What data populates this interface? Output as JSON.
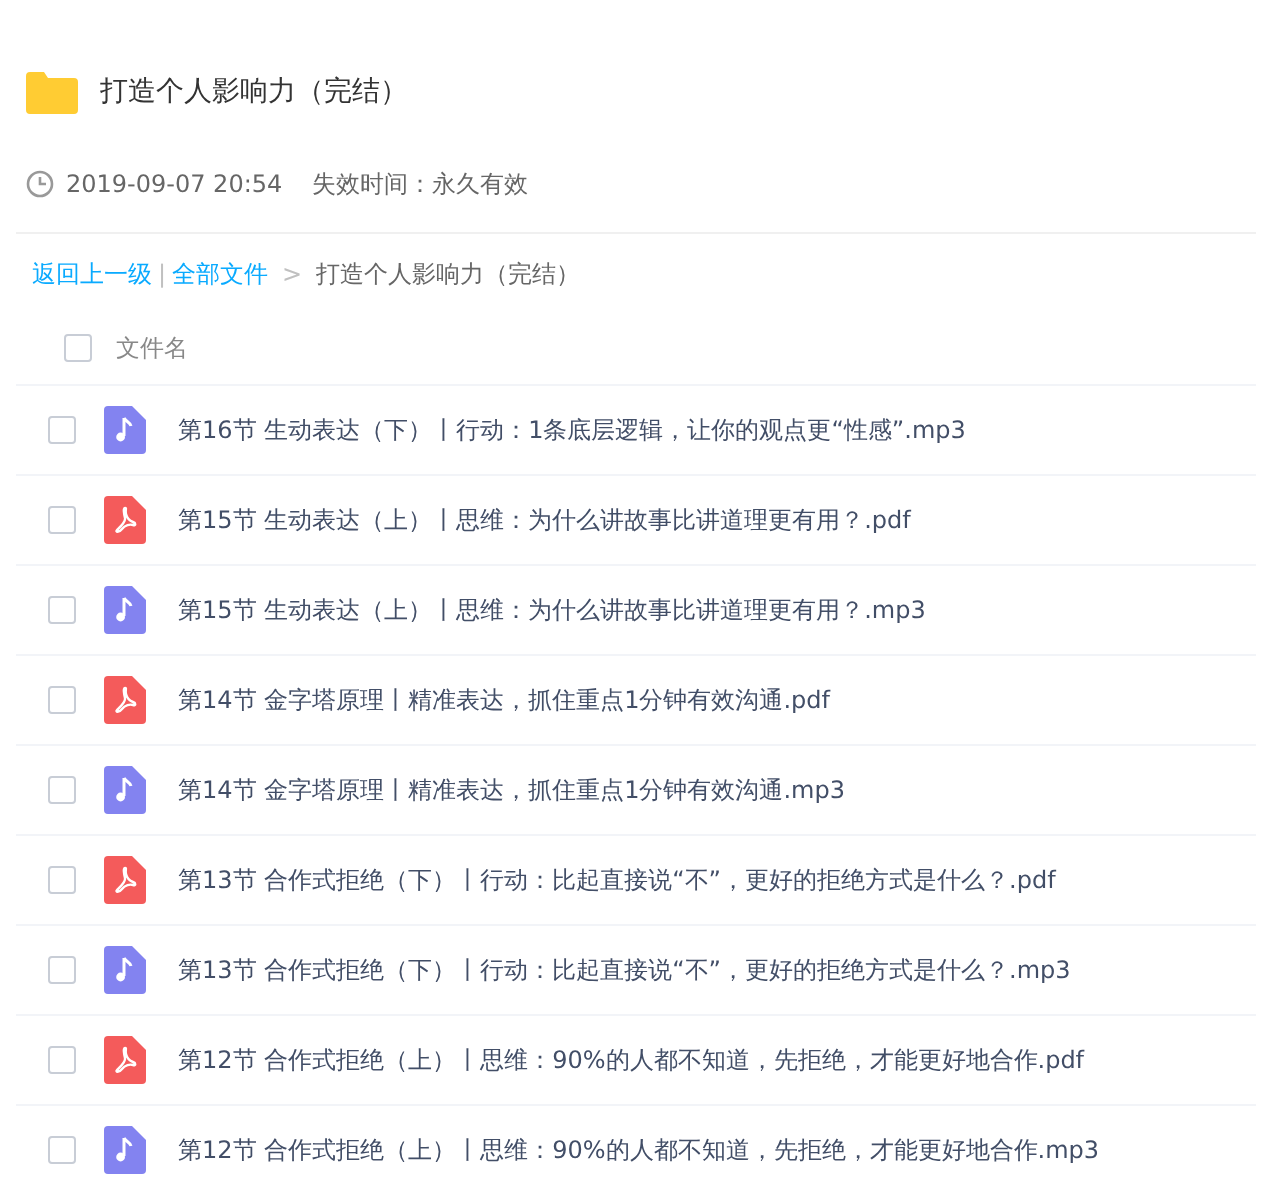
{
  "folder": {
    "title": "打造个人影响力（完结）",
    "date": "2019-09-07 20:54",
    "expiry": "失效时间：永久有效"
  },
  "breadcrumb": {
    "back": "返回上一级",
    "separator": "|",
    "root": "全部文件",
    "arrow": ">",
    "current": "打造个人影响力（完结）"
  },
  "table": {
    "header": {
      "label": "文件名",
      "checked": false
    },
    "rows": [
      {
        "kind": "audio",
        "name": "第16节 生动表达（下）丨行动：1条底层逻辑，让你的观点更“性感”.mp3",
        "checked": false
      },
      {
        "kind": "pdf",
        "name": "第15节 生动表达（上）丨思维：为什么讲故事比讲道理更有用？.pdf",
        "checked": false
      },
      {
        "kind": "audio",
        "name": "第15节 生动表达（上）丨思维：为什么讲故事比讲道理更有用？.mp3",
        "checked": false
      },
      {
        "kind": "pdf",
        "name": "第14节 金字塔原理丨精准表达，抓住重点1分钟有效沟通.pdf",
        "checked": false
      },
      {
        "kind": "audio",
        "name": "第14节 金字塔原理丨精准表达，抓住重点1分钟有效沟通.mp3",
        "checked": false
      },
      {
        "kind": "pdf",
        "name": "第13节 合作式拒绝（下）丨行动：比起直接说“不”，更好的拒绝方式是什么？.pdf",
        "checked": false
      },
      {
        "kind": "audio",
        "name": "第13节 合作式拒绝（下）丨行动：比起直接说“不”，更好的拒绝方式是什么？.mp3",
        "checked": false
      },
      {
        "kind": "pdf",
        "name": "第12节 合作式拒绝（上）丨思维：90%的人都不知道，先拒绝，才能更好地合作.pdf",
        "checked": false
      },
      {
        "kind": "audio",
        "name": "第12节 合作式拒绝（上）丨思维：90%的人都不知道，先拒绝，才能更好地合作.mp3",
        "checked": false
      }
    ]
  }
}
